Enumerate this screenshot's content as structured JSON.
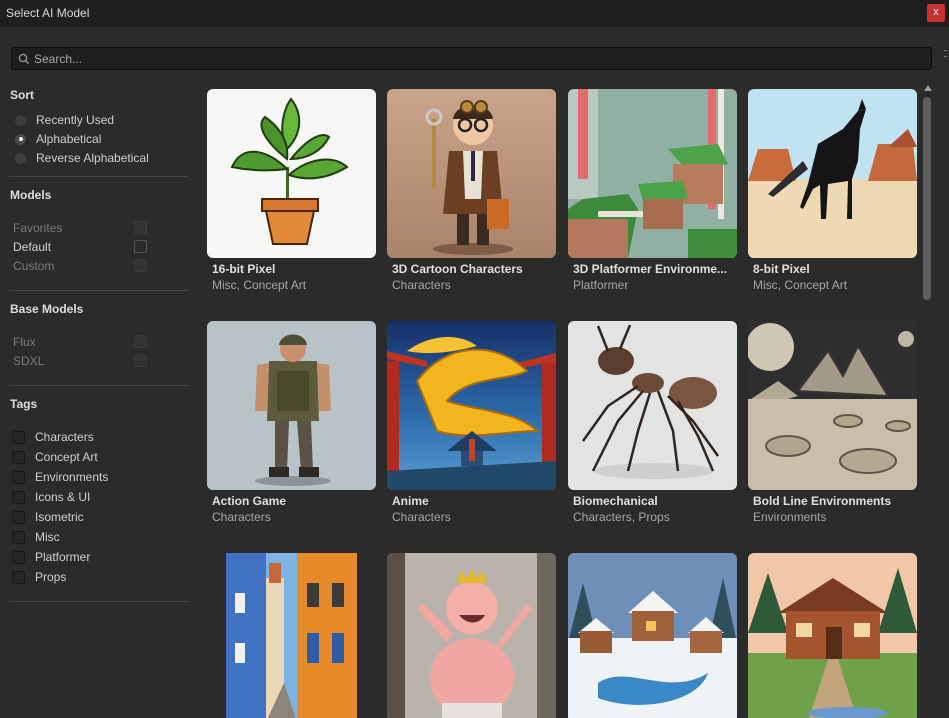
{
  "window": {
    "title": "Select AI Model",
    "close_label": "x"
  },
  "search": {
    "placeholder": "Search..."
  },
  "sort": {
    "title": "Sort",
    "options": [
      {
        "label": "Recently Used",
        "checked": false
      },
      {
        "label": "Alphabetical",
        "checked": true
      },
      {
        "label": "Reverse Alphabetical",
        "checked": false
      }
    ]
  },
  "models": {
    "title": "Models",
    "items": [
      {
        "label": "Favorites",
        "enabled": false
      },
      {
        "label": "Default",
        "enabled": true
      },
      {
        "label": "Custom",
        "enabled": false
      }
    ]
  },
  "base_models": {
    "title": "Base Models",
    "items": [
      {
        "label": "Flux"
      },
      {
        "label": "SDXL"
      }
    ]
  },
  "tags": {
    "title": "Tags",
    "items": [
      {
        "label": "Characters"
      },
      {
        "label": "Concept Art"
      },
      {
        "label": "Environments"
      },
      {
        "label": "Icons & UI"
      },
      {
        "label": "Isometric"
      },
      {
        "label": "Misc"
      },
      {
        "label": "Platformer"
      },
      {
        "label": "Props"
      }
    ]
  },
  "cards": [
    {
      "title": "16-bit Pixel",
      "subtitle": "Misc, Concept Art",
      "thumbnail": "potted-plant"
    },
    {
      "title": "3D Cartoon Characters",
      "subtitle": "Characters",
      "thumbnail": "steampunk-boy"
    },
    {
      "title": "3D Platformer Environme...",
      "subtitle": "Platformer",
      "thumbnail": "candy-platforms"
    },
    {
      "title": "8-bit Pixel",
      "subtitle": "Misc, Concept Art",
      "thumbnail": "pixel-horse"
    },
    {
      "title": "Action Game",
      "subtitle": "Characters",
      "thumbnail": "soldier"
    },
    {
      "title": "Anime",
      "subtitle": "Characters",
      "thumbnail": "golden-dragon"
    },
    {
      "title": "Biomechanical",
      "subtitle": "Characters, Props",
      "thumbnail": "metal-ant"
    },
    {
      "title": "Bold Line Environments",
      "subtitle": "Environments",
      "thumbnail": "moon-crater"
    },
    {
      "title": "",
      "subtitle": "",
      "thumbnail": "colorful-street"
    },
    {
      "title": "",
      "subtitle": "",
      "thumbnail": "cheering-king"
    },
    {
      "title": "",
      "subtitle": "",
      "thumbnail": "snowy-village"
    },
    {
      "title": "",
      "subtitle": "",
      "thumbnail": "log-cabin"
    }
  ]
}
